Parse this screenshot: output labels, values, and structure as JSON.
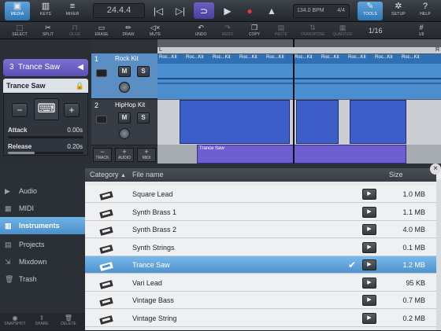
{
  "topbar": {
    "media": "MEDIA",
    "keys": "KEYS",
    "mixer": "MIXER",
    "time": "24.4.4",
    "tempo": "134.0 BPM",
    "signature": "4/4",
    "tools": "TOOLS",
    "setup": "SETUP",
    "help": "HELP"
  },
  "toolbar": {
    "select": "SELECT",
    "split": "SPLIT",
    "glue": "GLUE",
    "erase": "ERASE",
    "draw": "DRAW",
    "mute": "MUTE",
    "undo": "UNDO",
    "redo": "REDO",
    "copy": "COPY",
    "paste": "PASTE",
    "transpose": "TRANSPOSE",
    "quantize": "QUANTIZE",
    "page": "1/16"
  },
  "instrument": {
    "track_number": "3",
    "track_name": "Trance Saw",
    "preset": "Trance Saw",
    "attack_label": "Attack",
    "attack_value": "0.00s",
    "attack_level": 0.0,
    "release_label": "Release",
    "release_value": "0.20s",
    "release_level": 0.35
  },
  "tracks": [
    {
      "number": "1",
      "name": "Rock Kit",
      "m": "M",
      "s": "S"
    },
    {
      "number": "2",
      "name": "HipHop Kit",
      "m": "M",
      "s": "S"
    }
  ],
  "track_buttons": {
    "track": "TRACK",
    "audio": "AUDIO",
    "midi": "MIDI"
  },
  "clips": {
    "rock": "Roc...Kit",
    "trance": "Trance Saw"
  },
  "ruler": {
    "left": "L",
    "right": "R"
  },
  "browser": {
    "nav": [
      "Audio",
      "MIDI",
      "Instruments",
      "Projects",
      "Mixdown",
      "Trash"
    ],
    "selected_nav": "Instruments",
    "columns": {
      "category": "Category",
      "file": "File name",
      "size": "Size"
    },
    "rows": [
      {
        "name": "Square Lead",
        "size": "1.0 MB"
      },
      {
        "name": "Synth Brass 1",
        "size": "1.1 MB"
      },
      {
        "name": "Synth Brass 2",
        "size": "4.0 MB"
      },
      {
        "name": "Synth Strings",
        "size": "0.1 MB"
      },
      {
        "name": "Trance Saw",
        "size": "1.2 MB"
      },
      {
        "name": "Vari Lead",
        "size": "95 KB"
      },
      {
        "name": "Vintage Bass",
        "size": "0.7 MB"
      },
      {
        "name": "Vintage String",
        "size": "0.2 MB"
      }
    ],
    "bottom": {
      "snapshot": "SNAPSHOT",
      "share": "SHARE",
      "delete": "DELETE"
    }
  }
}
